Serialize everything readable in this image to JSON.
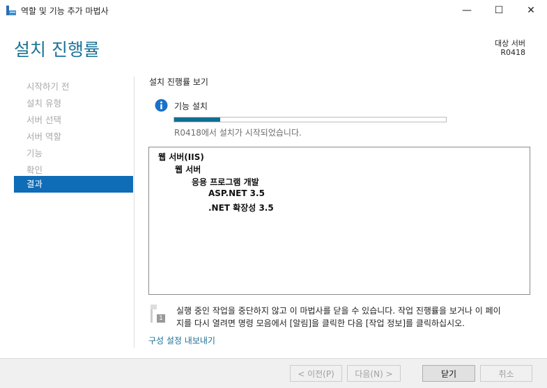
{
  "window": {
    "title": "역할 및 기능 추가 마법사",
    "minimize": "—",
    "maximize": "☐",
    "close": "✕"
  },
  "header": {
    "title": "설치 진행률",
    "target_label": "대상 서버",
    "target_server": "R0418"
  },
  "sidebar": {
    "items": [
      {
        "label": "시작하기 전"
      },
      {
        "label": "설치 유형"
      },
      {
        "label": "서버 선택"
      },
      {
        "label": "서버 역할"
      },
      {
        "label": "기능"
      },
      {
        "label": "확인"
      },
      {
        "label": "결과",
        "selected": true
      }
    ]
  },
  "main": {
    "heading": "설치 진행률 보기",
    "status_title": "기능 설치",
    "progress_percent": 17,
    "status_text": "R0418에서 설치가 시작되었습니다.",
    "tree": [
      {
        "label": "웹 서버(IIS)",
        "level": 0
      },
      {
        "label": "웹 서버",
        "level": 1
      },
      {
        "label": "응용 프로그램 개발",
        "level": 2
      },
      {
        "label": "ASP.NET 3.5",
        "level": 3
      },
      {
        "label": ".NET 확장성 3.5",
        "level": 3
      }
    ],
    "note_line1": "실행 중인 작업을 중단하지 않고 이 마법사를 닫을 수 있습니다. 작업 진행률을 보거나 이 페이",
    "note_line2": "지를 다시 열려면 명령 모음에서 [알림]을 클릭한 다음 [작업 정보]를 클릭하십시오.",
    "note_badge": "1",
    "export_link": "구성 설정 내보내기"
  },
  "footer": {
    "prev": "< 이전(P)",
    "next": "다음(N) >",
    "close": "닫기",
    "cancel": "취소"
  },
  "colors": {
    "accent": "#0f6cb6",
    "header": "#1a7396",
    "progress": "#0f6f93"
  }
}
